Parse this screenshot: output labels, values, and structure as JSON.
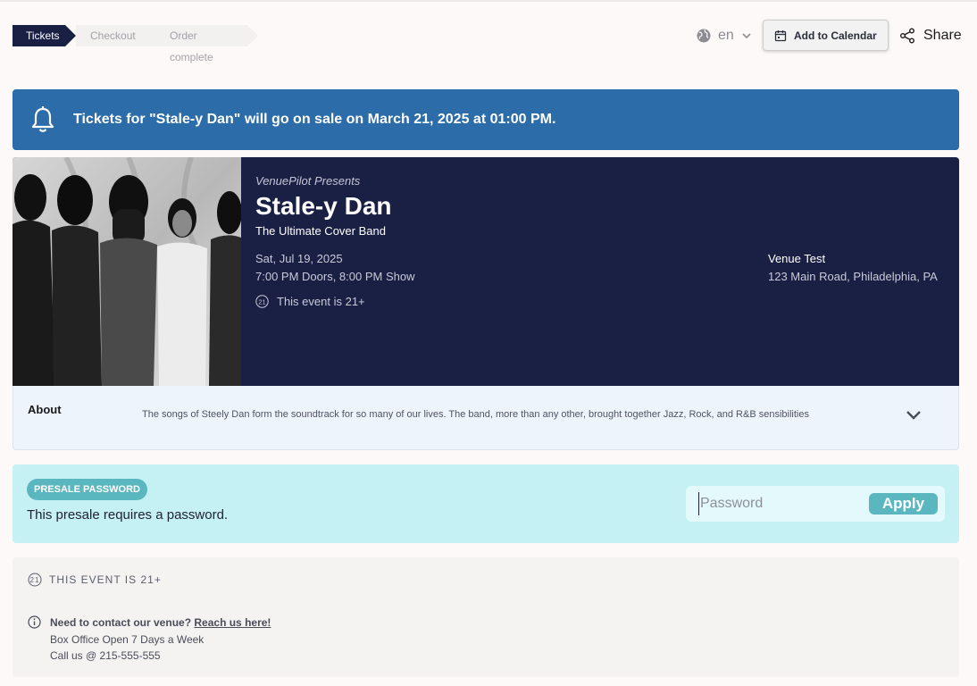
{
  "steps": {
    "tickets": "Tickets",
    "checkout": "Checkout",
    "complete": "Order complete"
  },
  "header": {
    "language": "en",
    "add_to_calendar": "Add to Calendar",
    "share": "Share"
  },
  "banner": {
    "text": "Tickets for \"Stale-y Dan\" will go on sale on March 21, 2025 at 01:00 PM."
  },
  "event": {
    "presenter": "VenuePilot Presents",
    "title": "Stale-y Dan",
    "subtitle": "The Ultimate Cover Band",
    "date": "Sat, Jul 19, 2025",
    "times": "7:00 PM Doors, 8:00 PM Show",
    "age_badge": "21",
    "age_text": "This event is 21+",
    "venue_name": "Venue Test",
    "venue_address": "123 Main Road, Philadelphia, PA"
  },
  "about": {
    "label": "About",
    "text": "The songs of Steely Dan form the soundtrack for so many of our lives. The band, more than any other, brought together Jazz, Rock, and R&B sensibilities"
  },
  "presale": {
    "badge": "PRESALE PASSWORD",
    "description": "This presale requires a password.",
    "password_placeholder": "Password",
    "apply": "Apply"
  },
  "info": {
    "age_badge": "21",
    "age_text": "THIS EVENT IS 21+",
    "contact_prompt": "Need to contact our venue?",
    "contact_link": "Reach us here!",
    "hours": "Box Office Open 7 Days a Week",
    "phone": "Call us @ 215-555-555"
  },
  "colors": {
    "navy": "#1a1f44",
    "banner_blue": "#2b6ca9",
    "presale_bg": "#c5f1f4",
    "teal": "#5bb7bf"
  }
}
